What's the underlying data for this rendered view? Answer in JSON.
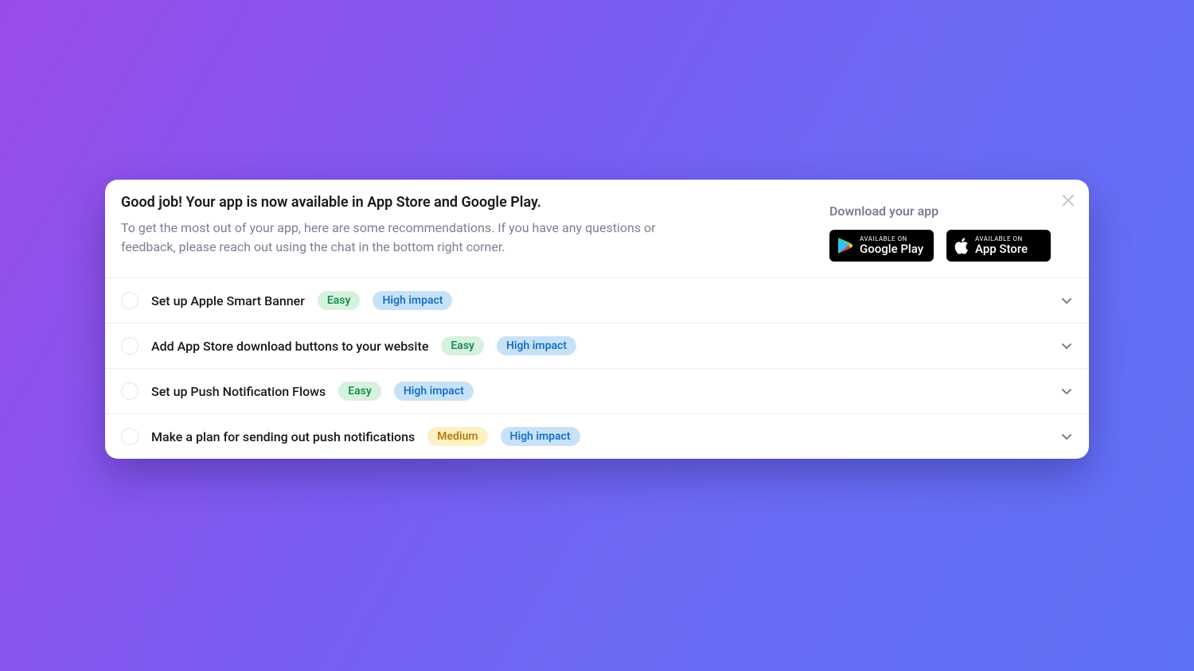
{
  "header": {
    "title": "Good job! Your app is now available in App Store and Google Play.",
    "subtitle": "To get the most out of your app, here are some recommendations. If you have any questions or feedback, please reach out using the chat in the bottom right corner.",
    "download_label": "Download your app",
    "google_play": {
      "top": "AVAILABLE ON",
      "bottom": "Google Play"
    },
    "app_store": {
      "top": "AVAILABLE ON",
      "bottom": "App Store"
    }
  },
  "badges": {
    "easy": "Easy",
    "medium": "Medium",
    "high_impact": "High impact"
  },
  "recommendations": [
    {
      "title": "Set up Apple Smart Banner",
      "difficulty": "easy",
      "impact": "high"
    },
    {
      "title": "Add App Store download buttons to your website",
      "difficulty": "easy",
      "impact": "high"
    },
    {
      "title": "Set up Push Notification Flows",
      "difficulty": "easy",
      "impact": "high"
    },
    {
      "title": "Make a plan for sending out push notifications",
      "difficulty": "medium",
      "impact": "high"
    }
  ]
}
